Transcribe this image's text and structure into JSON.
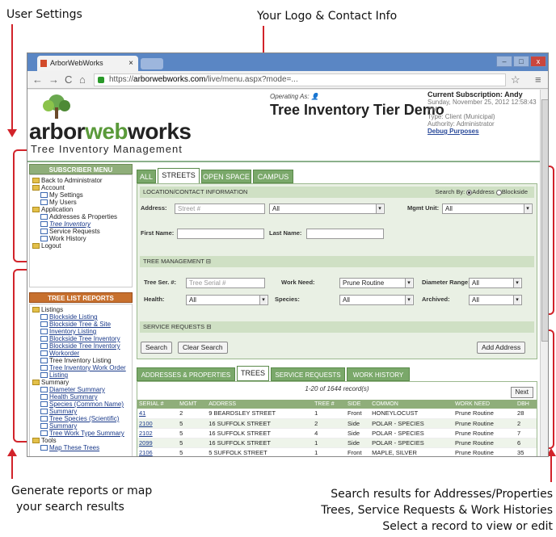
{
  "annotations": {
    "user_settings": "User Settings",
    "logo_contact": "Your Logo & Contact Info",
    "reports_line1": "Generate reports or map",
    "reports_line2": "your search results",
    "search_line1": "Search results for Addresses/Properties",
    "search_line2": "Trees, Service Requests & Work Histories",
    "search_line3": "Select a record to view or edit"
  },
  "browser": {
    "tab_title": "ArborWebWorks",
    "tab_close": "×",
    "url_prefix": "https://",
    "url_host": "arborwebworks.com",
    "url_path": "/live/menu.aspx?mode=...",
    "win_min": "–",
    "win_max": "□",
    "win_close": "x"
  },
  "header": {
    "logo_word_a": "arbor",
    "logo_word_b": "web",
    "logo_word_c": "works",
    "logo_sub": "Tree Inventory Management",
    "operating_as": "Operating As: 👤",
    "title": "Tree Inventory Tier Demo",
    "subscription": "Current Subscription: Andy",
    "date": "Sunday, November 25, 2012 12:58:43 PM",
    "type": "Type: Client (Municipal)",
    "authority": "Authority: Administrator",
    "debug": "Debug Purposes"
  },
  "sidebar": {
    "menu_title": "SUBSCRIBER MENU",
    "menu_items": [
      {
        "label": "Back to Administrator",
        "level": 1
      },
      {
        "label": "Account",
        "level": 1
      },
      {
        "label": "My Settings",
        "level": 2
      },
      {
        "label": "My Users",
        "level": 2
      },
      {
        "label": "Application",
        "level": 1
      },
      {
        "label": "Addresses & Properties",
        "level": 2
      },
      {
        "label": "Tree Inventory",
        "level": 2
      },
      {
        "label": "Service Requests",
        "level": 2
      },
      {
        "label": "Work History",
        "level": 2
      },
      {
        "label": "Logout",
        "level": 1
      }
    ],
    "reports_title": "TREE LIST REPORTS",
    "report_items": [
      {
        "label": "Listings",
        "level": 1
      },
      {
        "label": "Blockside Listing",
        "level": 2
      },
      {
        "label": "Blockside Tree & Site",
        "level": 2
      },
      {
        "label": "Inventory Listing",
        "level": 2
      },
      {
        "label": "Blockside Tree Inventory",
        "level": 2
      },
      {
        "label": "Blockside Tree Inventory",
        "level": 2
      },
      {
        "label": "Workorder",
        "level": 2
      },
      {
        "label": "Tree Inventory Listing",
        "level": 2
      },
      {
        "label": "Tree Inventory Work Order",
        "level": 2
      },
      {
        "label": "Listing",
        "level": 2
      },
      {
        "label": "Summary",
        "level": 1
      },
      {
        "label": "Diameter Summary",
        "level": 2
      },
      {
        "label": "Health Summary",
        "level": 2
      },
      {
        "label": "Species (Common Name)",
        "level": 2
      },
      {
        "label": "Summary",
        "level": 2
      },
      {
        "label": "Tree Species (Scientific)",
        "level": 2
      },
      {
        "label": "Summary",
        "level": 2
      },
      {
        "label": "Tree Work Type Summary",
        "level": 2
      },
      {
        "label": "Tools",
        "level": 1
      },
      {
        "label": "Map These Trees",
        "level": 2
      }
    ]
  },
  "search_tabs": [
    "ALL",
    "STREETS",
    "OPEN SPACE",
    "CAMPUS"
  ],
  "search": {
    "section1": "LOCATION/CONTACT INFORMATION",
    "search_by": "Search By:",
    "by_address": "Address",
    "by_blockside": "Blockside",
    "address_label": "Address:",
    "address_placeholder": "Street #",
    "address_select": "All",
    "mgmt_unit_label": "Mgmt Unit:",
    "mgmt_unit_value": "All",
    "first_name_label": "First Name:",
    "last_name_label": "Last Name:",
    "section2": "TREE MANAGEMENT ⊟",
    "tree_ser_label": "Tree Ser. #:",
    "tree_ser_placeholder": "Tree Serial #",
    "work_need_label": "Work Need:",
    "work_need_value": "Prune Routine",
    "diameter_label": "Diameter Range:",
    "diameter_value": "All",
    "health_label": "Health:",
    "health_value": "All",
    "species_label": "Species:",
    "species_value": "All",
    "archived_label": "Archived:",
    "archived_value": "All",
    "section3": "SERVICE REQUESTS ⊟",
    "search_btn": "Search",
    "clear_btn": "Clear Search",
    "add_btn": "Add Address"
  },
  "result_tabs": [
    "ADDRESSES & PROPERTIES",
    "TREES",
    "SERVICE REQUESTS",
    "WORK HISTORY"
  ],
  "results": {
    "count": "1-20 of 1644 record(s)",
    "next": "Next",
    "columns": [
      "SERIAL #",
      "MGMT",
      "ADDRESS",
      "TREE #",
      "SIDE",
      "COMMON",
      "WORK NEED",
      "DBH"
    ],
    "rows": [
      [
        "41",
        "2",
        "9 BEARDSLEY STREET",
        "1",
        "Front",
        "HONEYLOCUST",
        "Prune Routine",
        "28"
      ],
      [
        "2100",
        "5",
        "16 SUFFOLK STREET",
        "2",
        "Side",
        "POLAR - SPECIES",
        "Prune Routine",
        "2"
      ],
      [
        "2102",
        "5",
        "16 SUFFOLK STREET",
        "4",
        "Side",
        "POLAR - SPECIES",
        "Prune Routine",
        "7"
      ],
      [
        "2099",
        "5",
        "16 SUFFOLK STREET",
        "1",
        "Side",
        "POLAR - SPECIES",
        "Prune Routine",
        "6"
      ],
      [
        "2106",
        "5",
        "5 SUFFOLK STREET",
        "1",
        "Front",
        "MAPLE, SILVER",
        "Prune Routine",
        "35"
      ],
      [
        "3431",
        "4",
        "1 BARRETT PLACE",
        "2",
        "Front",
        "MAPLE, SILVER",
        "Prune Routine",
        "2"
      ]
    ]
  },
  "colors": {
    "accent_red": "#d2232a",
    "green": "#7aa86a",
    "orange": "#c7702e"
  }
}
